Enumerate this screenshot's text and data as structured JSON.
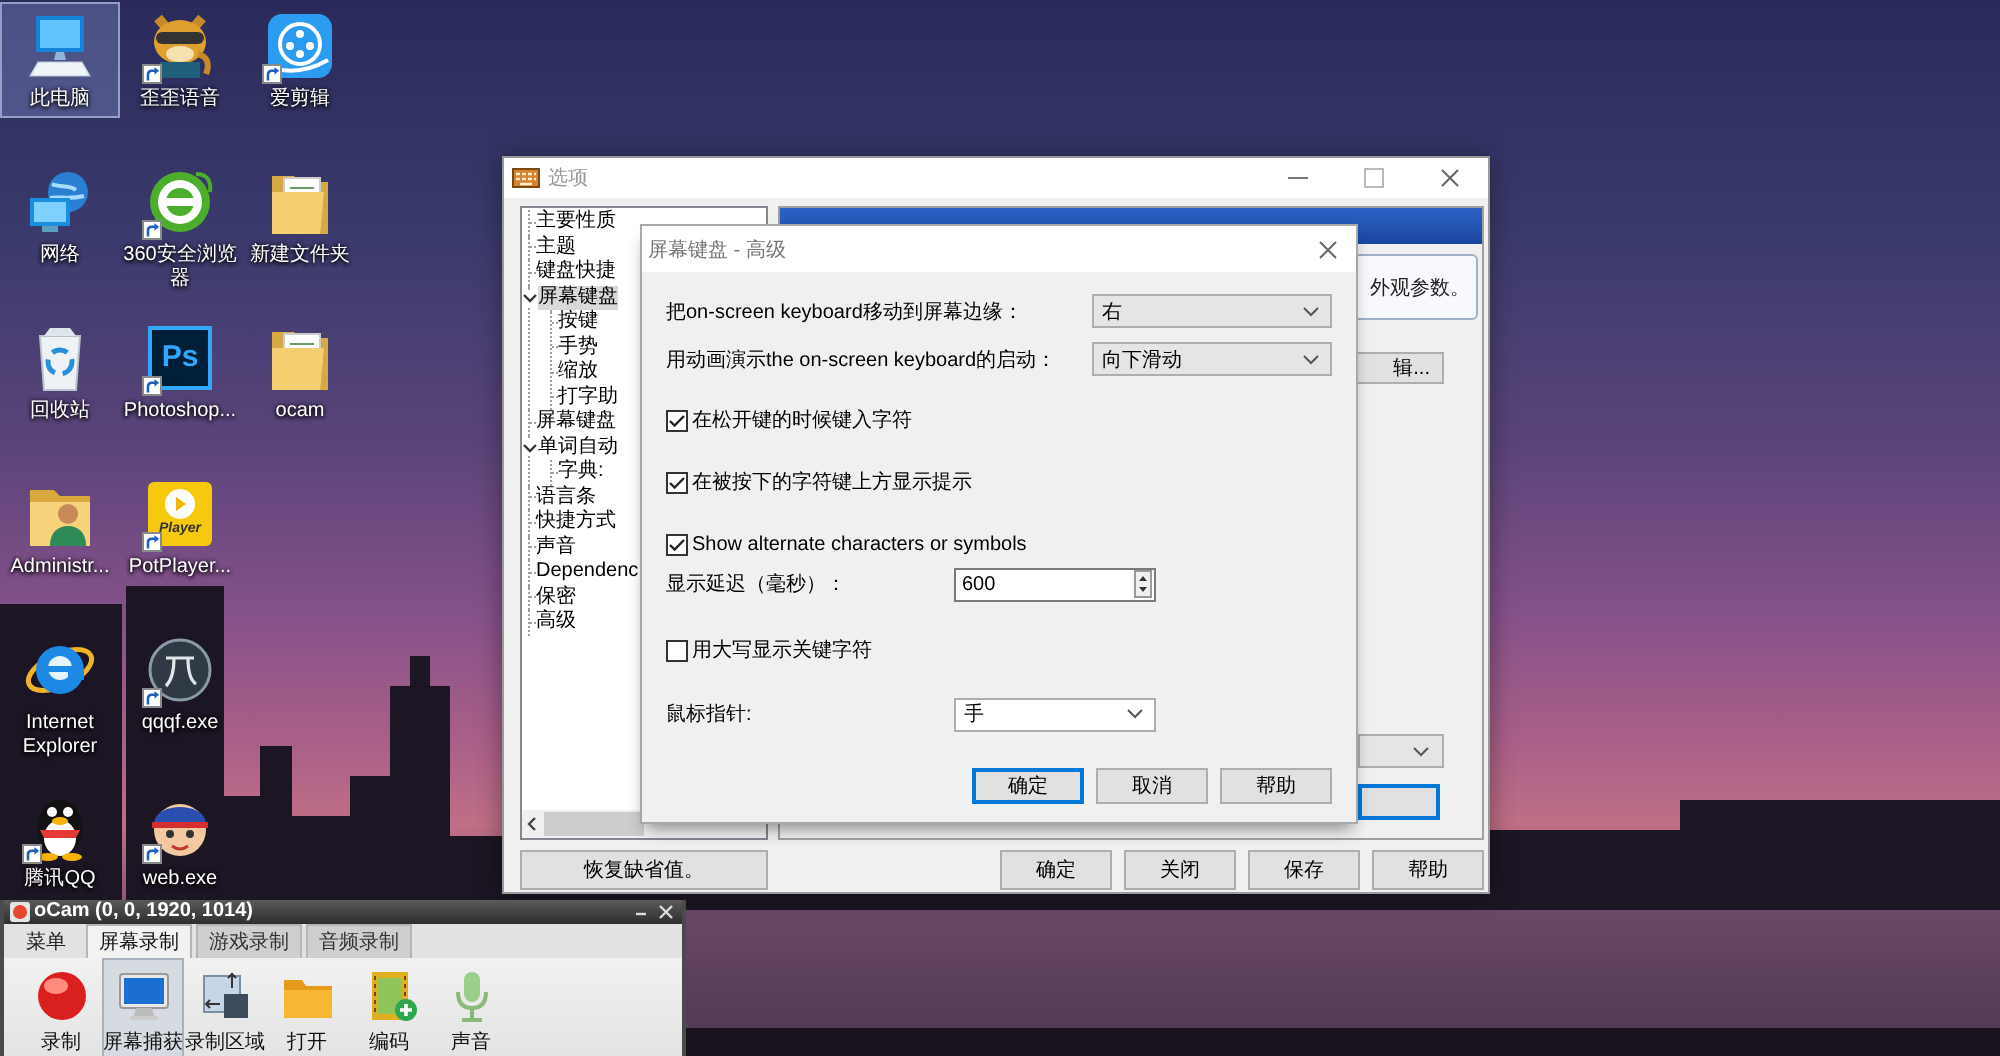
{
  "desktop_icons": [
    {
      "label": "此电脑",
      "kind": "computer",
      "shortcut": false,
      "selected": true
    },
    {
      "label": "网络",
      "kind": "network",
      "shortcut": false,
      "selected": false
    },
    {
      "label": "回收站",
      "kind": "recycle-bin",
      "shortcut": false,
      "selected": false
    },
    {
      "label": "Administr...",
      "kind": "user-folder",
      "shortcut": false,
      "selected": false
    },
    {
      "label": "Internet Explorer",
      "kind": "ie",
      "shortcut": false,
      "selected": false
    },
    {
      "label": "腾讯QQ",
      "kind": "penguin",
      "shortcut": true,
      "selected": false
    },
    {
      "label": "歪歪语音",
      "kind": "mascot",
      "shortcut": true,
      "selected": false
    },
    {
      "label": "360安全浏览器",
      "kind": "green-browser",
      "shortcut": true,
      "selected": false
    },
    {
      "label": "Photoshop...",
      "kind": "ps",
      "logo_text": "Ps",
      "shortcut": true,
      "selected": false
    },
    {
      "label": "PotPlayer...",
      "kind": "player",
      "logo_text": "Player",
      "shortcut": true,
      "selected": false
    },
    {
      "label": "qqqf.exe",
      "kind": "emblem",
      "shortcut": true,
      "selected": false
    },
    {
      "label": "web.exe",
      "kind": "cartoon",
      "shortcut": true,
      "selected": false
    },
    {
      "label": "爱剪辑",
      "kind": "video-editor",
      "shortcut": true,
      "selected": false
    },
    {
      "label": "新建文件夹",
      "kind": "folder",
      "shortcut": false,
      "selected": false
    },
    {
      "label": "ocam",
      "kind": "folder",
      "shortcut": false,
      "selected": false
    }
  ],
  "options_window": {
    "title": "选项",
    "tree": [
      {
        "label": "主要性质",
        "selected": false
      },
      {
        "label": "主题",
        "selected": false
      },
      {
        "label": "键盘快捷",
        "selected": false
      },
      {
        "label": "屏幕键盘",
        "selected": true,
        "expanded": true,
        "children": [
          {
            "label": "按键",
            "selected": false
          },
          {
            "label": "手势",
            "selected": false
          },
          {
            "label": "缩放",
            "selected": false
          },
          {
            "label": "打字助",
            "selected": false
          }
        ]
      },
      {
        "label": "屏幕键盘",
        "selected": false
      },
      {
        "label": "单词自动",
        "selected": false,
        "expanded": true,
        "children": [
          {
            "label": "字典:",
            "selected": false
          }
        ]
      },
      {
        "label": "语言条",
        "selected": false
      },
      {
        "label": "快捷方式",
        "selected": false
      },
      {
        "label": "声音",
        "selected": false
      },
      {
        "label": "Dependenc",
        "selected": false
      },
      {
        "label": "保密",
        "selected": false
      },
      {
        "label": "高级",
        "selected": false
      }
    ],
    "panel": {
      "description": "外观参数。",
      "button": "辑...",
      "bottom_button": {
        "focused": true
      }
    },
    "buttons": [
      "恢复缺省值。",
      "确定",
      "关闭",
      "保存",
      "帮助"
    ]
  },
  "advanced_dialog": {
    "title": "屏幕键盘 - 高级",
    "dropdown_rows": [
      {
        "label": "把on-screen keyboard移动到屏幕边缘：",
        "value": "右"
      },
      {
        "label": "用动画演示the on-screen keyboard的启动：",
        "value": "向下滑动"
      }
    ],
    "settings": [
      {
        "kind": "checkbox",
        "label": "在松开键的时候键入字符",
        "checked": true
      },
      {
        "kind": "checkbox",
        "label": "在被按下的字符键上方显示提示",
        "checked": true
      },
      {
        "kind": "checkbox",
        "label": "Show alternate characters or symbols",
        "checked": true
      },
      {
        "kind": "spinner",
        "label": "显示延迟（毫秒）：",
        "value": "600"
      },
      {
        "kind": "checkbox",
        "label": "用大写显示关键字符",
        "checked": false
      },
      {
        "kind": "dropdown",
        "label": "鼠标指针:",
        "value": "手"
      }
    ],
    "buttons": [
      {
        "label": "确定",
        "default": true
      },
      {
        "label": "取消",
        "default": false
      },
      {
        "label": "帮助",
        "default": false
      }
    ]
  },
  "ocam_window": {
    "title": "oCam (0, 0, 1920, 1014)",
    "menu": "菜单",
    "tabs": [
      {
        "label": "屏幕录制",
        "selected": true
      },
      {
        "label": "游戏录制",
        "selected": false
      },
      {
        "label": "音频录制",
        "selected": false
      }
    ],
    "tools": [
      {
        "label": "录制",
        "kind": "record",
        "selected": false
      },
      {
        "label": "屏幕捕获",
        "kind": "screen",
        "selected": true
      },
      {
        "label": "录制区域",
        "kind": "region",
        "selected": false
      },
      {
        "label": "打开",
        "kind": "open",
        "selected": false
      },
      {
        "label": "编码",
        "kind": "codec",
        "selected": false
      },
      {
        "label": "声音",
        "kind": "sound",
        "selected": false
      }
    ]
  }
}
